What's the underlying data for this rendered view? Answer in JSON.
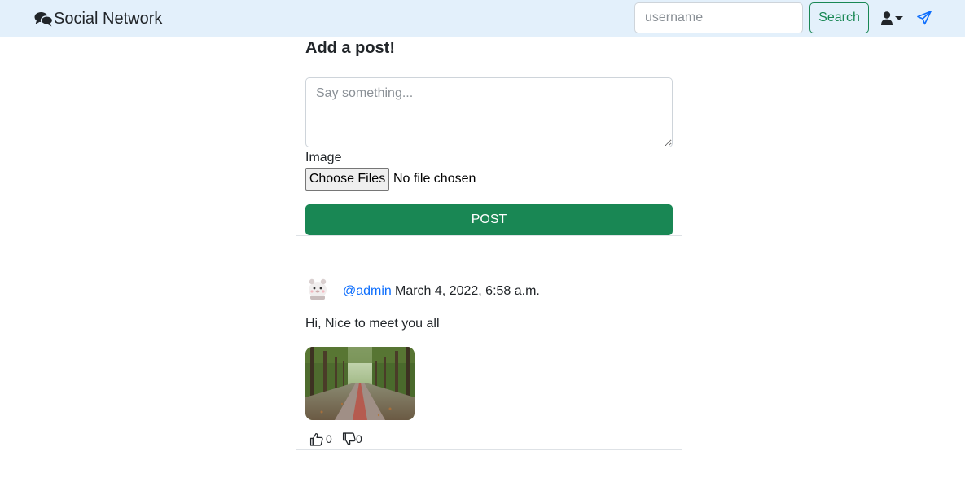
{
  "navbar": {
    "brand": "Social Network",
    "search_placeholder": "username",
    "search_button": "Search"
  },
  "post_form": {
    "title": "Add a post!",
    "content_placeholder": "Say something...",
    "image_label": "Image",
    "file_button": "Choose Files",
    "file_status": "No file chosen",
    "submit_label": "POST"
  },
  "posts": [
    {
      "author": "@admin",
      "date": "March 4, 2022, 6:58 a.m.",
      "text": "Hi, Nice to meet you all",
      "likes": "0",
      "dislikes": "0"
    }
  ],
  "colors": {
    "navbar_bg": "#e3f0fb",
    "success": "#198754",
    "link": "#0d6efd",
    "send_icon": "#0d6efd"
  }
}
